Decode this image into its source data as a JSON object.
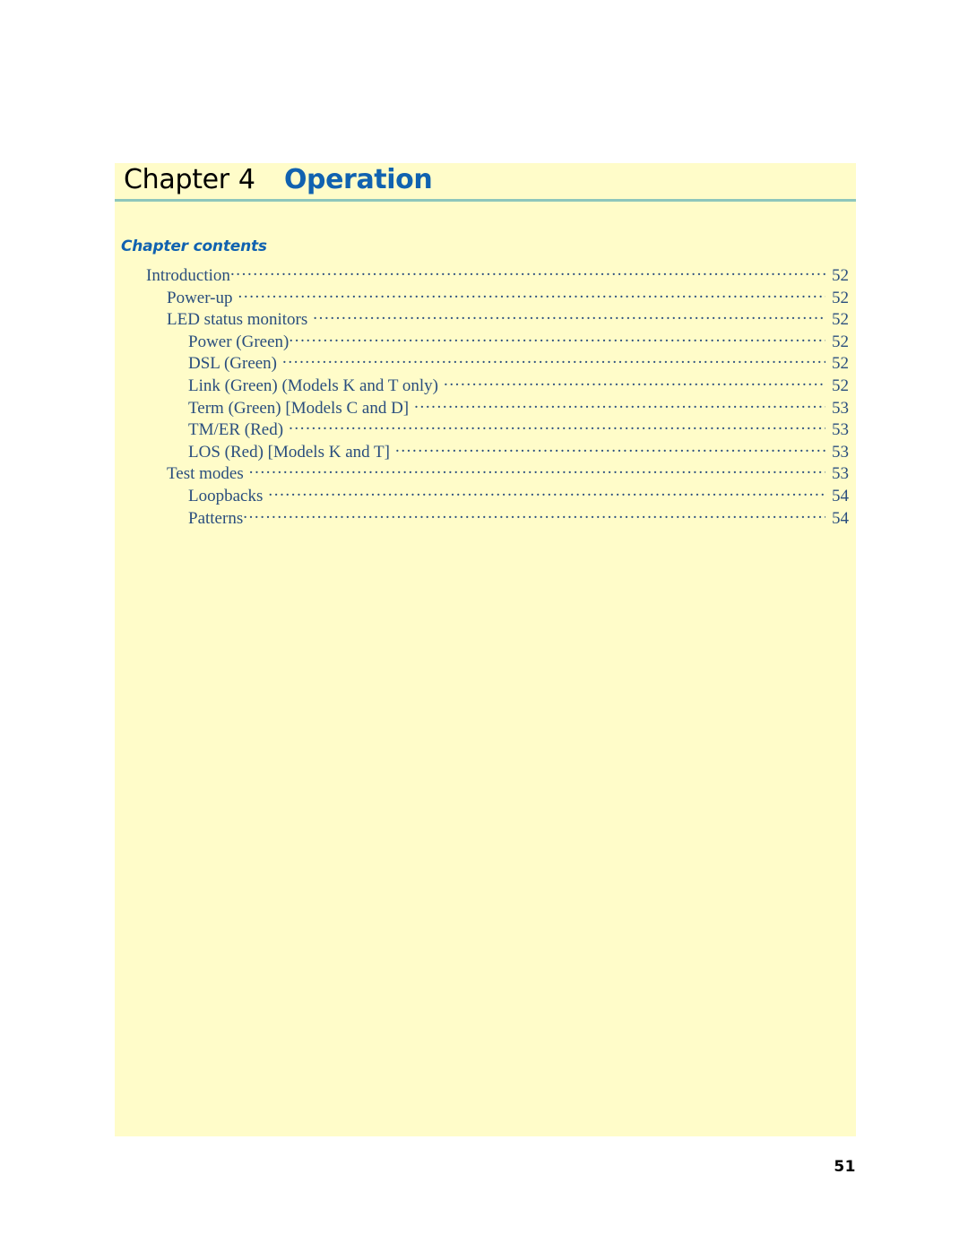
{
  "document": {
    "background_color": "#ffffff",
    "page_block_color": "#fffcc9",
    "rule_color": "#8ec6bc",
    "accent_color": "#1162b0",
    "toc_text_color": "#2a4e7e"
  },
  "header": {
    "chapter_word": "Chapter",
    "chapter_number": "4",
    "chapter_title": "Operation"
  },
  "contents": {
    "heading": "Chapter contents",
    "entries": [
      {
        "label": "Introduction",
        "page": "52",
        "level": 0,
        "gap": false
      },
      {
        "label": "Power-up",
        "page": "52",
        "level": 1,
        "gap": true
      },
      {
        "label": "LED status monitors",
        "page": "52",
        "level": 1,
        "gap": true
      },
      {
        "label": "Power (Green)",
        "page": "52",
        "level": 2,
        "gap": false
      },
      {
        "label": "DSL (Green)",
        "page": "52",
        "level": 2,
        "gap": true
      },
      {
        "label": "Link (Green) (Models K and T only)",
        "page": "52",
        "level": 2,
        "gap": true
      },
      {
        "label": "Term (Green) [Models C and D]",
        "page": "53",
        "level": 2,
        "gap": true
      },
      {
        "label": "TM/ER (Red)",
        "page": "53",
        "level": 2,
        "gap": true
      },
      {
        "label": "LOS (Red) [Models K and T]",
        "page": "53",
        "level": 2,
        "gap": true
      },
      {
        "label": "Test modes",
        "page": "53",
        "level": 1,
        "gap": true
      },
      {
        "label": "Loopbacks",
        "page": "54",
        "level": 2,
        "gap": true
      },
      {
        "label": "Patterns",
        "page": "54",
        "level": 2,
        "gap": false
      }
    ]
  },
  "footer": {
    "page_number": "51"
  }
}
